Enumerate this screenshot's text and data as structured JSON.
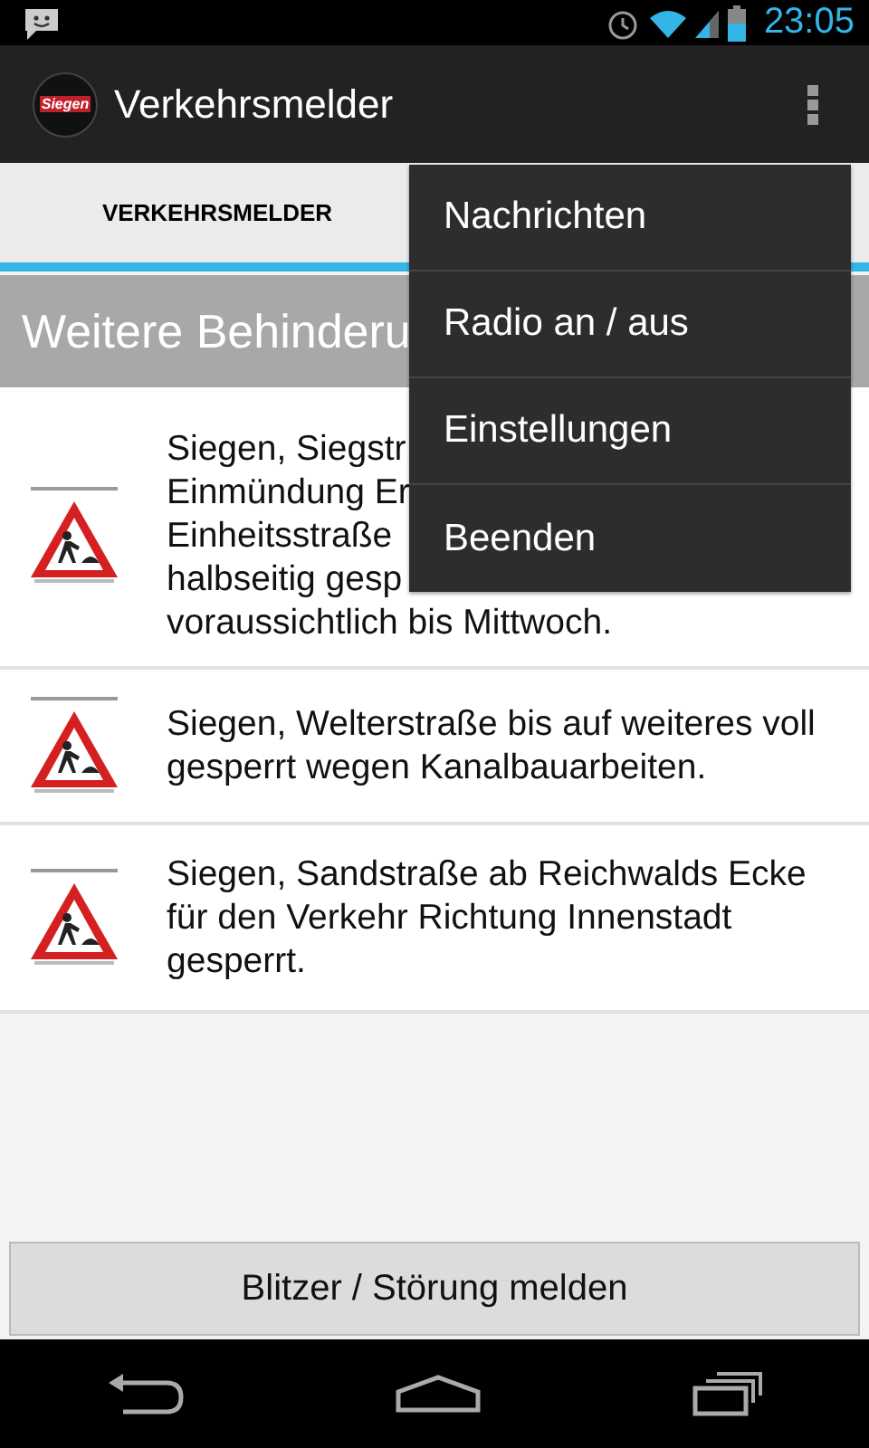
{
  "status_bar": {
    "time": "23:05"
  },
  "action_bar": {
    "logo_text": "Siegen",
    "title": "Verkehrsmelder"
  },
  "tabs": [
    {
      "label": "VERKEHRSMELDER",
      "selected": true
    }
  ],
  "section_header": "Weitere Behinderu",
  "items": [
    {
      "lines": [
        "Siegen, Siegstr",
        "Einmündung Er",
        "Einheitsstraße",
        "halbseitig gesp",
        "voraussichtlich bis Mittwoch."
      ]
    },
    {
      "lines": [
        "Siegen, Welterstraße bis auf weiteres voll gesperrt wegen Kanalbauarbeiten."
      ]
    },
    {
      "lines": [
        "Siegen, Sandstraße ab Reichwalds Ecke für den Verkehr Richtung Innenstadt gesperrt."
      ]
    }
  ],
  "menu": [
    "Nachrichten",
    "Radio an / aus",
    "Einstellungen",
    "Beenden"
  ],
  "report_button": "Blitzer / Störung melden"
}
